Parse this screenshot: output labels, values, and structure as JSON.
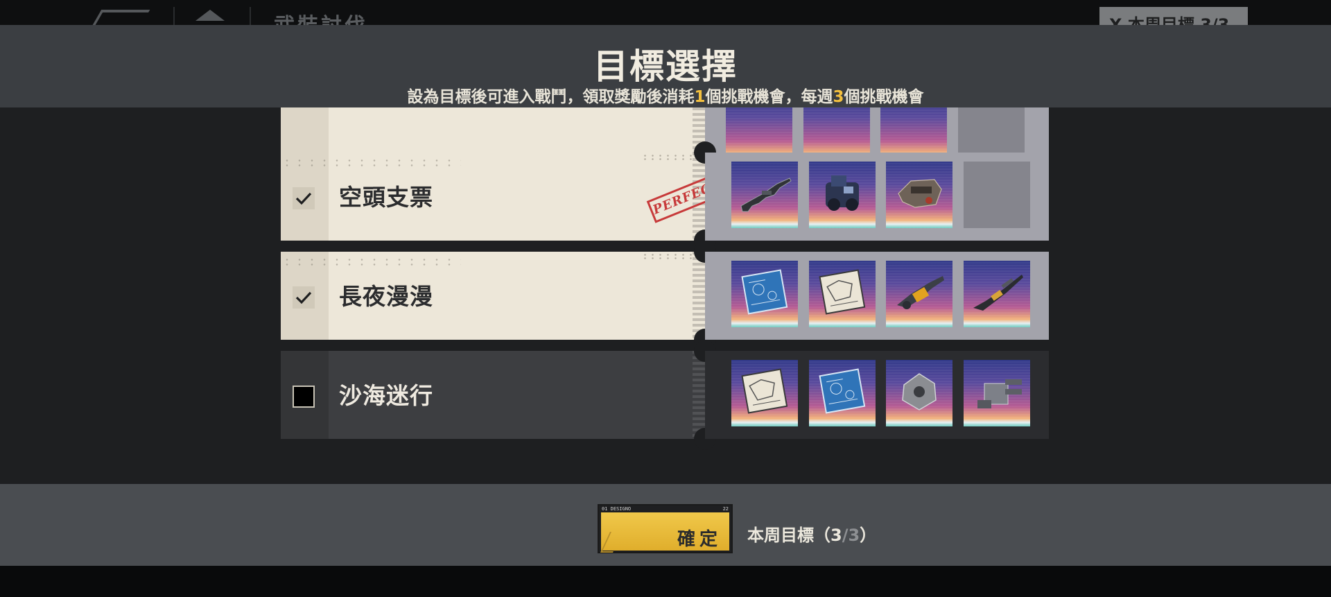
{
  "background": {
    "screen_title": "武裝討伐",
    "weekly_badge": "X 本周目標 3/3"
  },
  "modal": {
    "title": "目標選擇",
    "subtitle": {
      "part1": "設為目標後可進入戰鬥，領取獎勵後消耗",
      "num1": "1",
      "part2": "個挑戰機會，每週",
      "num2": "3",
      "part3": "個挑戰機會"
    }
  },
  "targets": [
    {
      "name": "",
      "selected": true,
      "rewards": [
        "reward-icon",
        "reward-icon",
        "reward-icon",
        "empty-slot"
      ]
    },
    {
      "name": "空頭支票",
      "selected": true,
      "stamp": "PERFECT",
      "rewards": [
        "rifle-icon",
        "armor-mech-icon",
        "gauntlet-icon",
        "empty-slot"
      ]
    },
    {
      "name": "長夜漫漫",
      "selected": true,
      "rewards": [
        "blueprint-icon",
        "schematic-icon",
        "cannon-icon",
        "sniper-rifle-icon"
      ]
    },
    {
      "name": "沙海迷行",
      "selected": false,
      "rewards": [
        "schematic-icon",
        "blueprint-icon",
        "armor-plate-icon",
        "turret-icon"
      ]
    }
  ],
  "footer": {
    "confirm_label": "確定",
    "confirm_code_left": "01 DESIGNO",
    "confirm_code_right": "22",
    "weekly_label": "本周目標（",
    "weekly_current": "3",
    "weekly_sep": "/",
    "weekly_total": "3",
    "weekly_close": "）"
  },
  "colors": {
    "accent": "#f4c03e",
    "card_active": "#ede7d9",
    "card_inactive": "#3d3e41",
    "stamp": "#c73a3a",
    "confirm_button": "#e8b93a"
  }
}
